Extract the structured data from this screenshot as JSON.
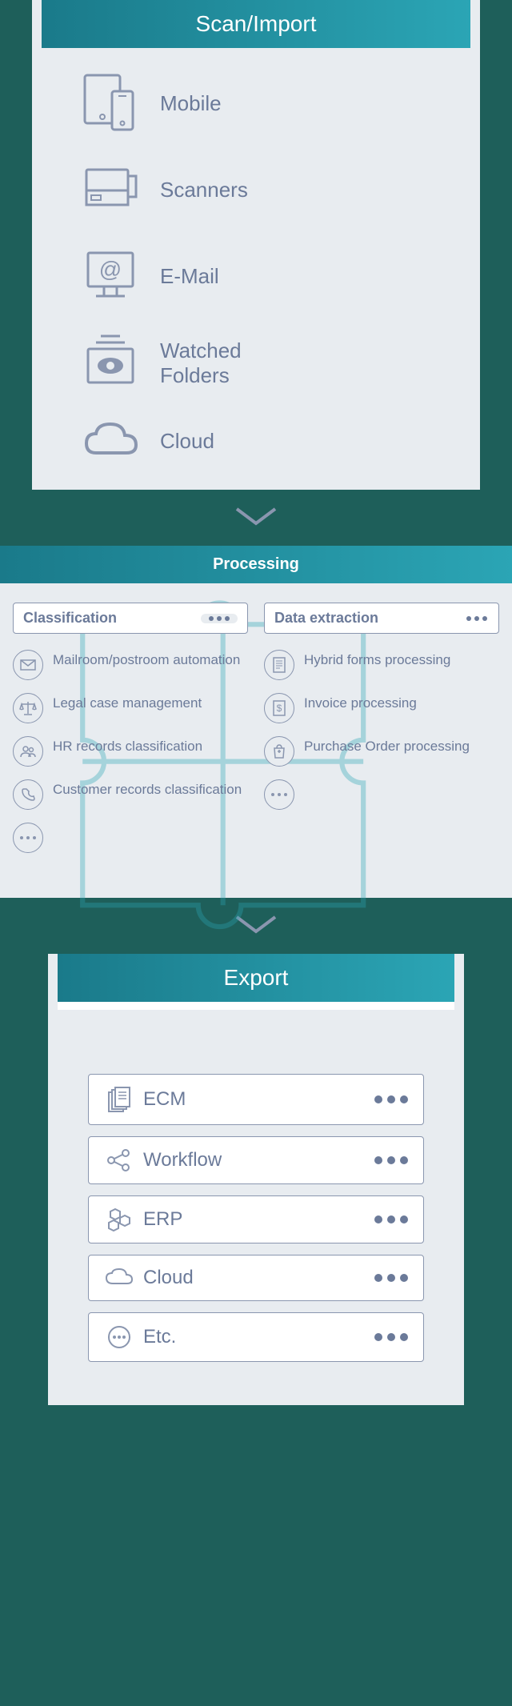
{
  "scan_import": {
    "title": "Scan/Import",
    "items": [
      {
        "label": "Mobile",
        "icon": "mobile"
      },
      {
        "label": "Scanners",
        "icon": "scanner"
      },
      {
        "label": "E-Mail",
        "icon": "email"
      },
      {
        "label": "Watched\nFolders",
        "icon": "watched-folder"
      },
      {
        "label": "Cloud",
        "icon": "cloud"
      }
    ]
  },
  "processing": {
    "title": "Processing",
    "classification": {
      "label": "Classification",
      "items": [
        {
          "label": "Mailroom/postroom automation",
          "icon": "envelope"
        },
        {
          "label": "Legal case management",
          "icon": "scales"
        },
        {
          "label": "HR records classification",
          "icon": "people"
        },
        {
          "label": "Customer records classification",
          "icon": "phone"
        }
      ],
      "more": true
    },
    "extraction": {
      "label": "Data extraction",
      "items": [
        {
          "label": "Hybrid forms processing",
          "icon": "form"
        },
        {
          "label": "Invoice processing",
          "icon": "invoice"
        },
        {
          "label": "Purchase Order processing",
          "icon": "purchase"
        }
      ],
      "more": true
    }
  },
  "export": {
    "title": "Export",
    "items": [
      {
        "label": "ECM",
        "icon": "documents"
      },
      {
        "label": "Workflow",
        "icon": "workflow"
      },
      {
        "label": "ERP",
        "icon": "hexagons"
      },
      {
        "label": "Cloud",
        "icon": "cloud-sm"
      },
      {
        "label": "Etc.",
        "icon": "more"
      }
    ]
  }
}
